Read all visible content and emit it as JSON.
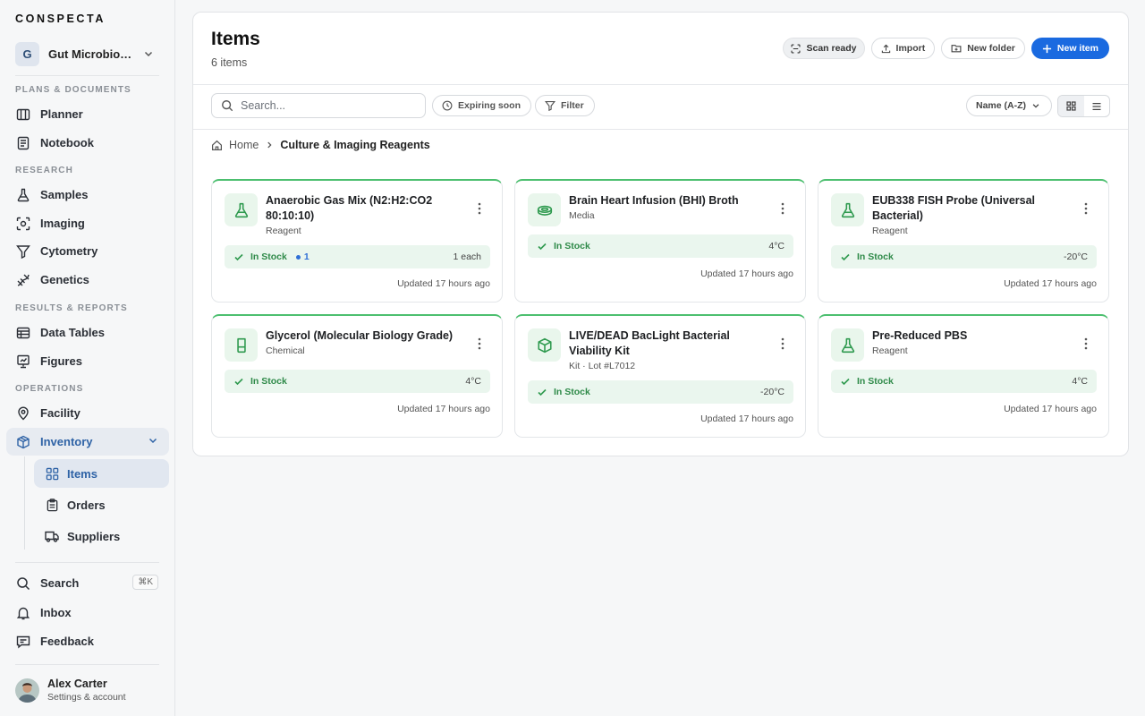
{
  "brand": "CONSPECTA",
  "workspace": {
    "initial": "G",
    "name": "Gut Microbiome Lab"
  },
  "sidebar": {
    "sections": [
      {
        "label": "PLANS & DOCUMENTS"
      },
      {
        "label": "RESEARCH"
      },
      {
        "label": "RESULTS & REPORTS"
      },
      {
        "label": "OPERATIONS"
      }
    ],
    "items": {
      "planner": "Planner",
      "notebook": "Notebook",
      "samples": "Samples",
      "imaging": "Imaging",
      "cytometry": "Cytometry",
      "genetics": "Genetics",
      "data_tables": "Data Tables",
      "figures": "Figures",
      "facility": "Facility",
      "inventory": "Inventory",
      "items": "Items",
      "orders": "Orders",
      "suppliers": "Suppliers",
      "search": "Search",
      "search_shortcut": "⌘K",
      "inbox": "Inbox",
      "feedback": "Feedback"
    }
  },
  "user": {
    "name": "Alex Carter",
    "subtitle": "Settings & account"
  },
  "header": {
    "title": "Items",
    "count": "6 items",
    "scan": "Scan ready",
    "import": "Import",
    "new_folder": "New folder",
    "new_item": "New item"
  },
  "toolbar": {
    "search_placeholder": "Search...",
    "expiring": "Expiring soon",
    "filter": "Filter",
    "sort": "Name (A-Z)"
  },
  "breadcrumb": {
    "home": "Home",
    "current": "Culture & Imaging Reagents"
  },
  "accent": "#1a6ae0",
  "stock_color": "#4cbf6f",
  "items": [
    {
      "name": "Anaerobic Gas Mix (N2:H2:CO2 80:10:10)",
      "type": "Reagent",
      "icon": "flask-icon",
      "status": "In Stock",
      "badge": "1",
      "qty": "1 each",
      "updated": "Updated 17 hours ago"
    },
    {
      "name": "Brain Heart Infusion (BHI) Broth",
      "type": "Media",
      "icon": "petri-dish-icon",
      "status": "In Stock",
      "qty": "4°C",
      "updated": "Updated 17 hours ago"
    },
    {
      "name": "EUB338 FISH Probe (Universal Bacterial)",
      "type": "Reagent",
      "icon": "flask-icon",
      "status": "In Stock",
      "qty": "-20°C",
      "updated": "Updated 17 hours ago"
    },
    {
      "name": "Glycerol (Molecular Biology Grade)",
      "type": "Chemical",
      "icon": "beaker-icon",
      "status": "In Stock",
      "qty": "4°C",
      "updated": "Updated 17 hours ago"
    },
    {
      "name": "LIVE/DEAD BacLight Bacterial Viability Kit",
      "type": "Kit · Lot #L7012",
      "icon": "box-icon",
      "status": "In Stock",
      "qty": "-20°C",
      "updated": "Updated 17 hours ago"
    },
    {
      "name": "Pre-Reduced PBS",
      "type": "Reagent",
      "icon": "flask-icon",
      "status": "In Stock",
      "qty": "4°C",
      "updated": "Updated 17 hours ago"
    }
  ]
}
